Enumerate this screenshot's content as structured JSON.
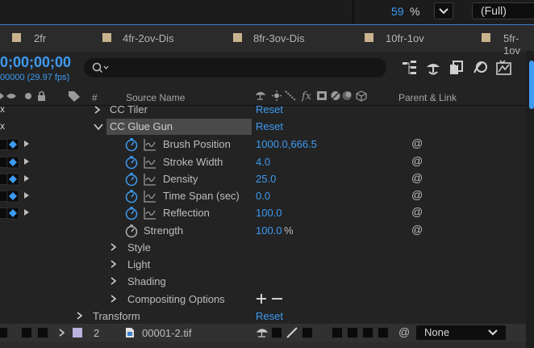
{
  "viewer": {
    "zoom": "59",
    "zoom_unit": "%",
    "resolution": "(Full)"
  },
  "tabs": [
    "2fr",
    "4fr-2ov-Dis",
    "8fr-3ov-Dis",
    "10fr-1ov",
    "5fr-1ov"
  ],
  "timeline": {
    "timecode": "0;00;00;00",
    "fps": "00000 (29.97 fps)",
    "search_placeholder": ""
  },
  "columns": {
    "num": "#",
    "source": "Source Name",
    "parent": "Parent & Link"
  },
  "effects": [
    {
      "name": "CC Tiler",
      "reset": "Reset"
    },
    {
      "name": "CC Glue Gun",
      "reset": "Reset"
    }
  ],
  "properties": [
    {
      "name": "Brush Position",
      "value": "1000.0,666.5"
    },
    {
      "name": "Stroke Width",
      "value": "4.0"
    },
    {
      "name": "Density",
      "value": "25.0"
    },
    {
      "name": "Time Span (sec)",
      "value": "0.0"
    },
    {
      "name": "Reflection",
      "value": "100.0"
    },
    {
      "name": "Strength",
      "value": "100.0",
      "unit": "%"
    }
  ],
  "groups": [
    "Style",
    "Light",
    "Shading",
    "Compositing Options"
  ],
  "transform": {
    "name": "Transform",
    "reset": "Reset"
  },
  "layer": {
    "number": "2",
    "name": "00001-2.tif",
    "parent": "None"
  },
  "colors": {
    "accent": "#3d9bf2",
    "swatch": "#c9b38e",
    "label": "#b9b3e0"
  }
}
